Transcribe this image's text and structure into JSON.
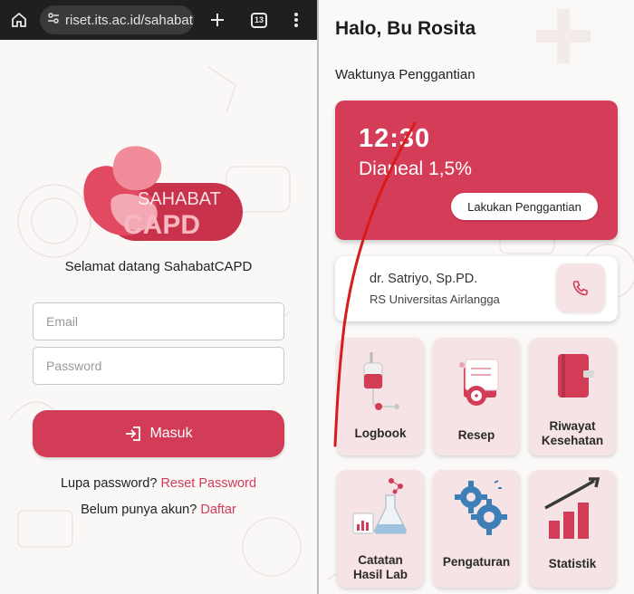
{
  "browser": {
    "url": "riset.its.ac.id/sahabat",
    "tab_count": "13",
    "icons": [
      "home-icon",
      "site-settings-icon",
      "new-tab-plus-icon",
      "tab-switcher-icon",
      "more-vert-icon"
    ]
  },
  "login": {
    "logo_word1": "SAHABAT",
    "logo_word2": "CAPD",
    "welcome": "Selamat datang SahabatCAPD",
    "email_placeholder": "Email",
    "password_placeholder": "Password",
    "submit_label": "Masuk",
    "forgot_text": "Lupa password?",
    "reset_link": "Reset Password",
    "no_account_text": "Belum punya akun?",
    "register_link": "Daftar"
  },
  "dashboard": {
    "greeting": "Halo, Bu Rosita",
    "section_title": "Waktunya Penggantian",
    "schedule": {
      "time": "12:30",
      "solution": "Dianeal 1,5%",
      "action_label": "Lakukan Penggantian"
    },
    "doctor": {
      "name": "dr. Satriyo, Sp.PD.",
      "hospital": "RS Universitas Airlangga"
    },
    "menu": [
      {
        "label": "Logbook"
      },
      {
        "label": "Resep"
      },
      {
        "label": "Riwayat Kesehatan"
      },
      {
        "label": "Catatan Hasil Lab"
      },
      {
        "label": "Pengaturan"
      },
      {
        "label": "Statistik"
      }
    ]
  },
  "colors": {
    "brand_red": "#d23c57",
    "card_pink": "#f6e3e5",
    "browser_bar": "#1f1f1f"
  }
}
